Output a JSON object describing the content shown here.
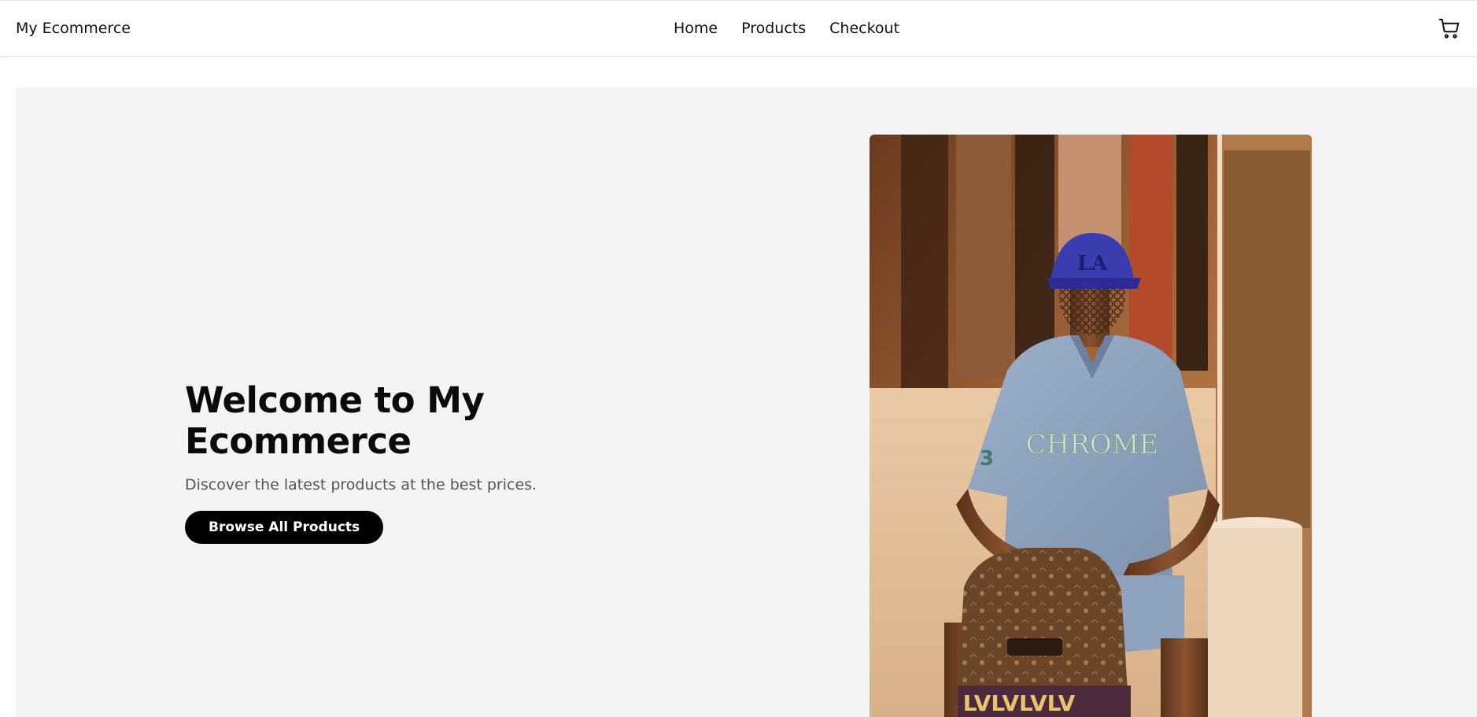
{
  "header": {
    "brand": "My Ecommerce",
    "nav": [
      "Home",
      "Products",
      "Checkout"
    ],
    "cart_icon": "shopping-cart-icon"
  },
  "hero": {
    "title_line1": "Welcome to My",
    "title_line2": "Ecommerce",
    "subtitle": "Discover the latest products at the best prices.",
    "cta_label": "Browse All Products",
    "image": {
      "cap_text": "LA",
      "shirt_text": "CHROME",
      "bag_text": "LVLVLVLV"
    }
  },
  "colors": {
    "hero_background": "#f4f4f4",
    "cta_background": "#000000",
    "cta_text": "#ffffff",
    "cap": "#3a3cb0",
    "shirt": "#8fa5c2",
    "bag": "#6a4528"
  }
}
